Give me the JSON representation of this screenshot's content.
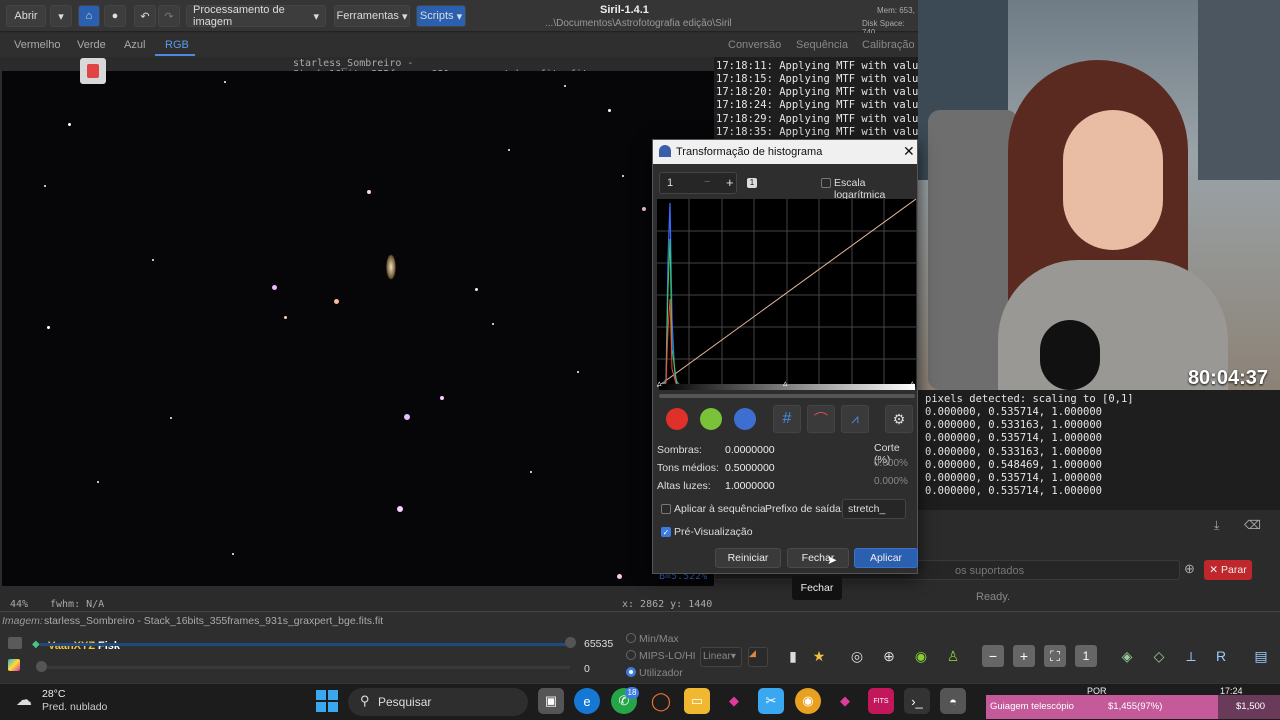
{
  "app": {
    "title": "Siril-1.4.1",
    "path": "...\\Documentos\\Astrofotografia edição\\Siril",
    "mem": "Mem: 653,",
    "disk": "Disk Space: 740"
  },
  "toolbar": {
    "open_label": "Abrir",
    "processing_label": "Processamento de imagem",
    "tools_label": "Ferramentas",
    "scripts_label": "Scripts"
  },
  "channels": [
    "Vermelho",
    "Verde",
    "Azul",
    "RGB"
  ],
  "right_tabs": [
    "Conversão",
    "Sequência",
    "Calibração"
  ],
  "image": {
    "title": "starless_Sombreiro - Stack_16bits_355frames_931s_graxpert_bge.fits.fit",
    "zoom": "44%",
    "fwhm": "fwhm: N/A",
    "coords": "x: 2862 y: 1440",
    "b_value": "B=5.522%"
  },
  "console": {
    "lines": [
      "17:18:11: Applying MTF with values",
      "17:18:15: Applying MTF with values",
      "17:18:20: Applying MTF with values",
      "17:18:24: Applying MTF with values",
      "17:18:29: Applying MTF with values",
      "17:18:35: Applying MTF with values"
    ],
    "lines2": [
      "pixels detected: scaling to [0,1]",
      "0.000000, 0.535714, 1.000000",
      "0.000000, 0.533163, 1.000000",
      "0.000000, 0.535714, 1.000000",
      "0.000000, 0.533163, 1.000000",
      "0.000000, 0.548469, 1.000000",
      "0.000000, 0.535714, 1.000000",
      "0.000000, 0.535714, 1.000000"
    ],
    "supported_hint": "os suportados",
    "stop_label": "Parar",
    "ready": "Ready."
  },
  "webcam": {
    "timer": "80:04:37"
  },
  "dialog": {
    "title": "Transformação de histograma",
    "zoom_value": "1",
    "log_scale_label": "Escala logarítmica",
    "shadows_label": "Sombras:",
    "shadows_value": "0.0000000",
    "midtones_label": "Tons médios:",
    "midtones_value": "0.5000000",
    "highlights_label": "Altas luzes:",
    "highlights_value": "1.0000000",
    "clip_label": "Corte (%)",
    "clip_low": "0.000%",
    "clip_high": "0.000%",
    "apply_seq_label": "Aplicar à sequência",
    "prefix_label": "Prefixo de saída:",
    "prefix_value": "stretch_",
    "preview_label": "Pré-Visualização",
    "reset_label": "Reiniciar",
    "close_label": "Fechar",
    "apply_label": "Aplicar",
    "tooltip": "Fechar"
  },
  "bottom": {
    "image_label": "Imagem:",
    "image_name": "starless_Sombreiro - Stack_16bits_355frames_931s_graxpert_bge.fits.fit",
    "user": "VaanXYZ",
    "user_suffix": "Fisk",
    "max_value": "65535",
    "min_value": "0",
    "opt_minmax": "Min/Max",
    "opt_mips": "MIPS-LO/HI",
    "opt_user": "Utilizador",
    "scale_mode": "Linear"
  },
  "taskbar": {
    "weather_temp": "28°C",
    "weather_desc": "Pred. nublado",
    "search_placeholder": "Pesquisar",
    "badge": "18",
    "alert_text": "Guiagem telescópio",
    "alert_value": "$1,455(97%)",
    "alert_value2": "$1,500",
    "lang": "POR",
    "time": "17:24"
  },
  "colors": {
    "accent": "#2b5fb0",
    "stop": "#c0272d",
    "alert": "#c45a9a"
  }
}
